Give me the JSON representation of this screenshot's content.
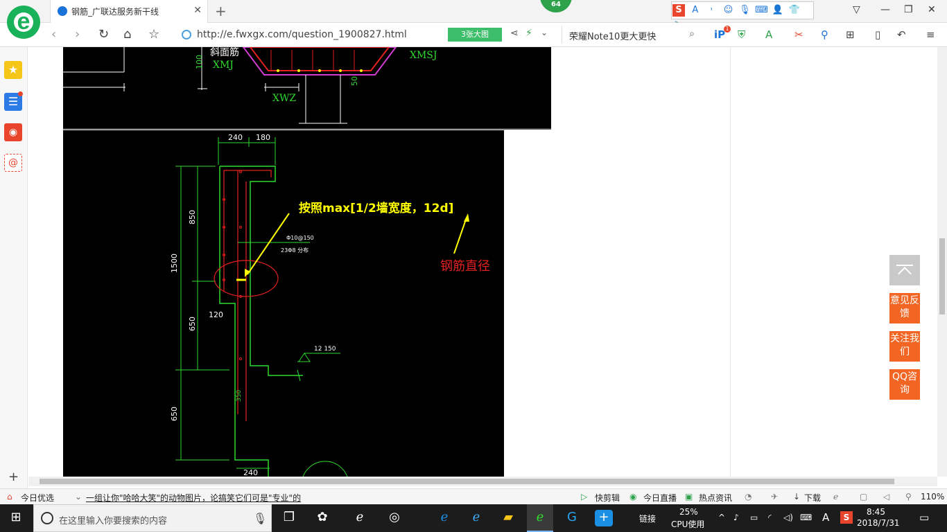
{
  "browser": {
    "tab_title": "钢筋_广联达服务新干线",
    "new_tab": "+",
    "tab_close": "✕",
    "badge": "64",
    "url": "http://e.fwxgx.com/question_1900827.html",
    "big_image_label": "3张大图",
    "search_query": "荣耀Note10更大更快",
    "ext_badge": "1"
  },
  "drawing_top": {
    "labels": [
      "斜面筋",
      "XMJ",
      "XMSJ",
      "XWZ",
      "100",
      "50"
    ]
  },
  "drawing_main": {
    "dims_top": [
      "240",
      "180"
    ],
    "dims_left": [
      "850",
      "1500",
      "650",
      "650"
    ],
    "dim_120": "120",
    "bottom_dim": "240",
    "rebar_note_1": "Φ10@150",
    "rebar_note_2": "23Φ8 分布",
    "right_note": "12 150",
    "vert_note": "350",
    "annotation_yellow": "按照max[1/2墙宽度，12d]",
    "annotation_red": "钢筋直径"
  },
  "float_buttons": {
    "feedback": "意见反馈",
    "follow": "关注我们",
    "qq": "QQ咨询"
  },
  "statusbar": {
    "left_label": "今日优选",
    "headline": "一组让你\"哈哈大笑\"的动物图片，论搞笑它们可是\"专业\"的",
    "quick_clip": "快剪辑",
    "live": "今日直播",
    "news": "热点资讯",
    "download": "下载",
    "zoom": "110%"
  },
  "taskbar": {
    "search_placeholder": "在这里输入你要搜索的内容",
    "link_label": "链接",
    "cpu_percent": "25%",
    "cpu_label": "CPU使用",
    "ime": "A",
    "time": "8:45",
    "date": "2018/7/31"
  }
}
